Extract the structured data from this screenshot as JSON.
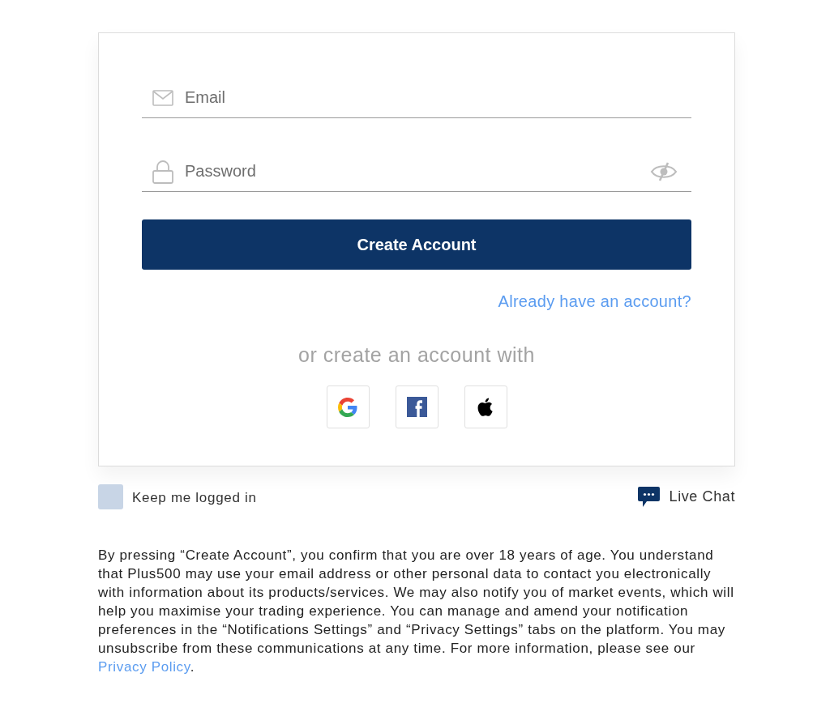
{
  "signup_form": {
    "fields": [
      {
        "kind": "email",
        "placeholder": "Email"
      },
      {
        "kind": "password",
        "placeholder": "Password"
      }
    ],
    "submit_button": "Create Account",
    "login_link": "Already have an account?",
    "social_prompt": "or create an account with",
    "social_buttons": [
      {
        "kind": "google"
      },
      {
        "kind": "facebook"
      },
      {
        "kind": "apple"
      }
    ]
  },
  "keep_logged_in": {
    "label": "Keep me logged in",
    "checked": false
  },
  "live_chat": {
    "label": "Live Chat"
  },
  "disclaimer": {
    "text": "By pressing “Create Account”, you confirm that you are over 18 years of age. You understand that Plus500 may use your email address or other personal data to contact you electronically with information about its products/services. We may also notify you of market events, which will help you maximise your trading experience. You can manage and amend your notification preferences in the “Notifications Settings” and “Privacy Settings” tabs on the platform. You may unsubscribe from these communications at any time. For more information, please see our",
    "link": "Privacy Policy",
    "end": "."
  }
}
